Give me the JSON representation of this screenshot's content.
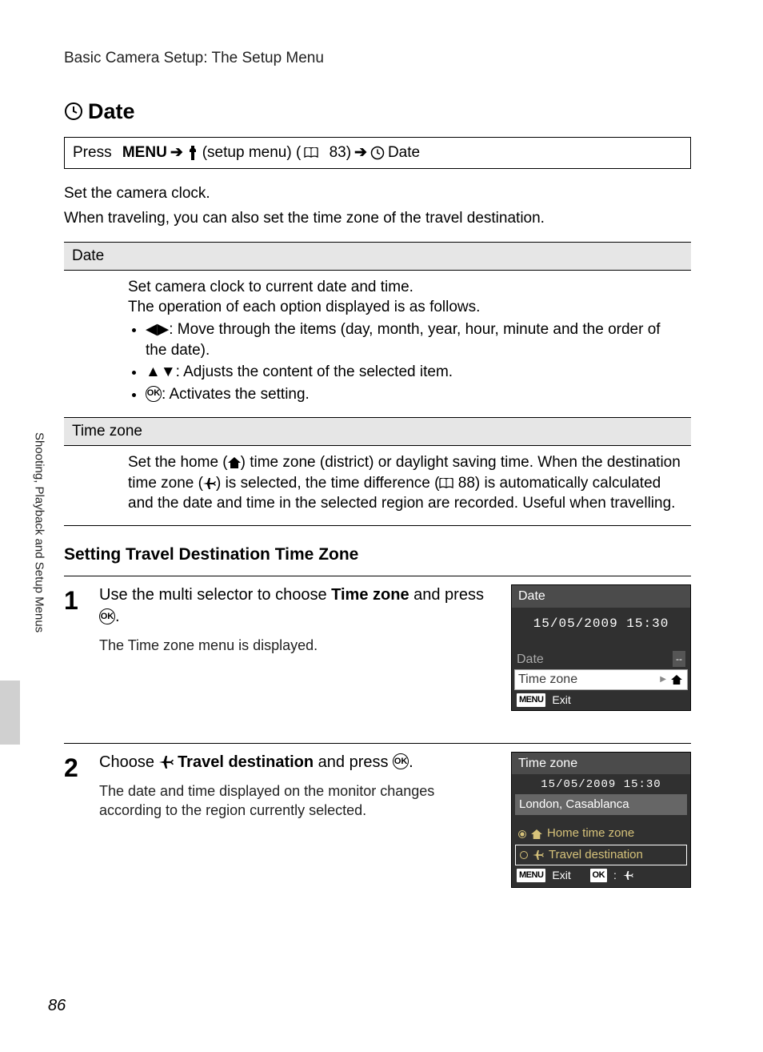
{
  "breadcrumb": "Basic Camera Setup: The Setup Menu",
  "section_title": "Date",
  "nav": {
    "press": "Press",
    "menu": "MENU",
    "setup": "(setup menu) (",
    "pageref": "83)",
    "date": "Date"
  },
  "intro": {
    "p1": "Set the camera clock.",
    "p2": "When traveling, you can also set the time zone of the travel destination."
  },
  "table": {
    "row1_head": "Date",
    "row1": {
      "l1": "Set camera clock to current date and time.",
      "l2": "The operation of each option displayed is as follows.",
      "b1": ": Move through the items (day, month, year, hour, minute and the order of the date).",
      "b2": ": Adjusts the content of the selected item.",
      "b3": ": Activates the setting."
    },
    "row2_head": "Time zone",
    "row2": {
      "t1": "Set the home (",
      "t2": ") time zone (district) or daylight saving time. When the destination time zone (",
      "t3": ") is selected, the time difference (",
      "t3_ref": "88) is automatically calculated and the date and time in the selected region are recorded. Useful when travelling."
    }
  },
  "subheading": "Setting Travel Destination Time Zone",
  "steps": {
    "s1": {
      "num": "1",
      "lead_a": "Use the multi selector to choose ",
      "lead_b": "Time zone",
      "lead_c": " and press ",
      "desc": "The Time zone menu is displayed."
    },
    "s2": {
      "num": "2",
      "lead_a": "Choose ",
      "lead_b": "Travel destination",
      "lead_c": " and press ",
      "desc": "The date and time displayed on the monitor changes according to the region currently selected."
    }
  },
  "screen1": {
    "title": "Date",
    "datetime": "15/05/2009 15:30",
    "row1": "Date",
    "row1_val": "--",
    "row2": "Time zone",
    "exit": "Exit"
  },
  "screen2": {
    "title": "Time zone",
    "datetime": "15/05/2009 15:30",
    "location": "London, Casablanca",
    "opt1": "Home time zone",
    "opt2": "Travel destination",
    "exit": "Exit"
  },
  "side_label": "Shooting, Playback and Setup Menus",
  "page_number": "86"
}
